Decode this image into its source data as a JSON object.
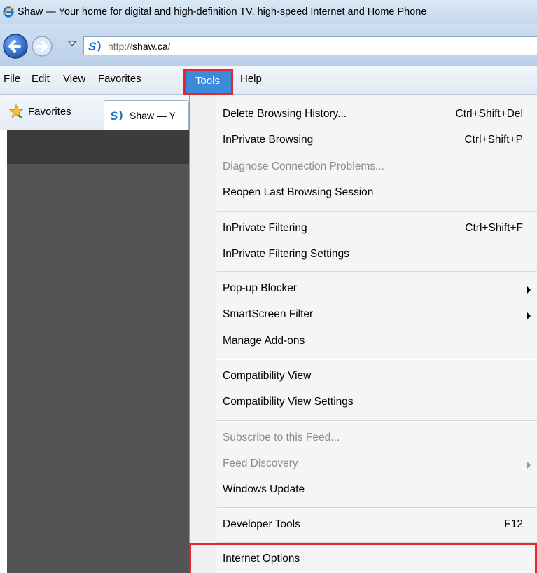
{
  "window": {
    "title": "Shaw — Your home for digital and high-definition TV, high-speed Internet and Home Phone",
    "icon": "ie-logo-icon"
  },
  "address": {
    "url_prefix": "http://",
    "url_host": "shaw.ca",
    "url_suffix": "/",
    "site_icon": "shaw-logo-icon"
  },
  "menubar": {
    "items": [
      "File",
      "Edit",
      "View",
      "Favorites",
      "Tools",
      "Help"
    ],
    "active": "Tools"
  },
  "favorites_bar": {
    "favorites_label": "Favorites",
    "tab_label": "Shaw — Y"
  },
  "tools_menu": {
    "items": [
      {
        "label": "Delete Browsing History...",
        "shortcut": "Ctrl+Shift+Del",
        "enabled": true
      },
      {
        "label": "InPrivate Browsing",
        "shortcut": "Ctrl+Shift+P",
        "enabled": true
      },
      {
        "label": "Diagnose Connection Problems...",
        "shortcut": "",
        "enabled": false
      },
      {
        "label": "Reopen Last Browsing Session",
        "shortcut": "",
        "enabled": true
      },
      {
        "label": "InPrivate Filtering",
        "shortcut": "Ctrl+Shift+F",
        "enabled": true
      },
      {
        "label": "InPrivate Filtering Settings",
        "shortcut": "",
        "enabled": true
      },
      {
        "label": "Pop-up Blocker",
        "shortcut": "",
        "submenu": true,
        "enabled": true
      },
      {
        "label": "SmartScreen Filter",
        "shortcut": "",
        "submenu": true,
        "enabled": true
      },
      {
        "label": "Manage Add-ons",
        "shortcut": "",
        "enabled": true
      },
      {
        "label": "Compatibility View",
        "shortcut": "",
        "enabled": true
      },
      {
        "label": "Compatibility View Settings",
        "shortcut": "",
        "enabled": true
      },
      {
        "label": "Subscribe to this Feed...",
        "shortcut": "",
        "enabled": false
      },
      {
        "label": "Feed Discovery",
        "shortcut": "",
        "submenu": true,
        "enabled": false
      },
      {
        "label": "Windows Update",
        "shortcut": "",
        "enabled": true
      },
      {
        "label": "Developer Tools",
        "shortcut": "F12",
        "enabled": true
      },
      {
        "label": "Internet Options",
        "shortcut": "",
        "enabled": true,
        "highlighted": true
      }
    ]
  },
  "colors": {
    "highlight_border": "#e5262c",
    "menu_selected": "#3c8bd8",
    "disabled_text": "#8c8c8c"
  }
}
